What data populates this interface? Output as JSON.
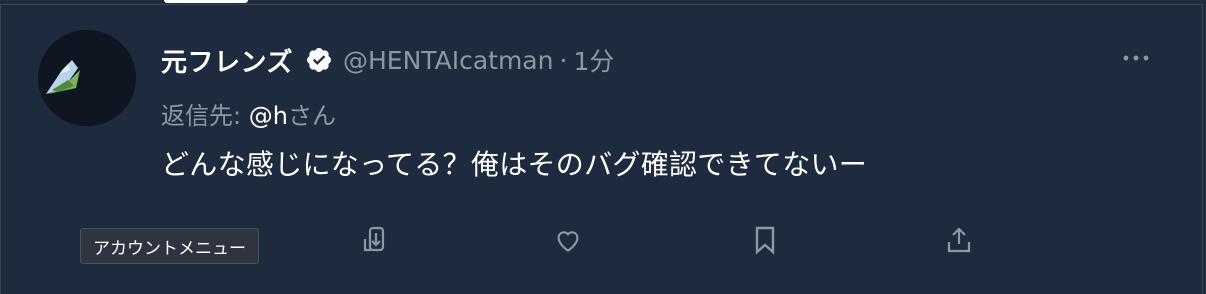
{
  "tweet": {
    "display_name": "元フレンズ",
    "handle": "@HENTAIcatman",
    "separator": "·",
    "time": "1分",
    "reply_label": "返信先:",
    "reply_user": "@h",
    "reply_suffix": "さん",
    "text": "どんな感じになってる？俺はそのバグ確認できてないー"
  },
  "tooltip": {
    "text": "アカウントメニュー"
  },
  "icons": {
    "more": "more-icon",
    "verified": "verified-badge-icon",
    "reply": "reply-icon",
    "retweet": "retweet-icon",
    "like": "like-icon",
    "bookmark": "bookmark-icon",
    "share": "share-icon"
  },
  "colors": {
    "background": "#1e2a3e",
    "primary_text": "#ffffff",
    "secondary_text": "#8b98a5",
    "icon": "#8b98a5"
  }
}
